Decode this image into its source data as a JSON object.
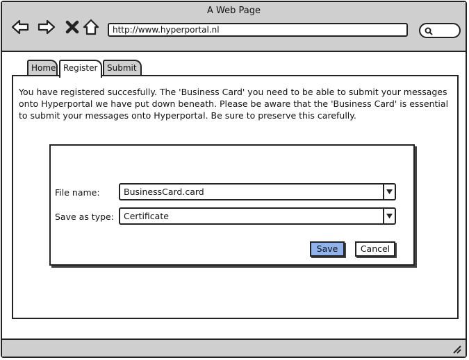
{
  "window": {
    "title": "A Web Page"
  },
  "browser": {
    "url": "http://www.hyperportal.nl"
  },
  "tabs": [
    {
      "label": "Home"
    },
    {
      "label": "Register"
    },
    {
      "label": "Submit"
    }
  ],
  "main": {
    "message": "You have registered succesfully. The 'Business Card' you need to be able to submit your messages onto Hyperportal we have put down beneath. Please be aware that the 'Business Card' is essential to submit your messages onto Hyperportal. Be sure to preserve this carefully."
  },
  "dialog": {
    "file_name_label": "File name:",
    "file_name_value": "BusinessCard.card",
    "save_type_label": "Save as type:",
    "save_type_value": "Certificate",
    "save_label": "Save",
    "cancel_label": "Cancel"
  },
  "colors": {
    "primary_button": "#8fb3ea",
    "chrome": "#cfcfcf"
  }
}
